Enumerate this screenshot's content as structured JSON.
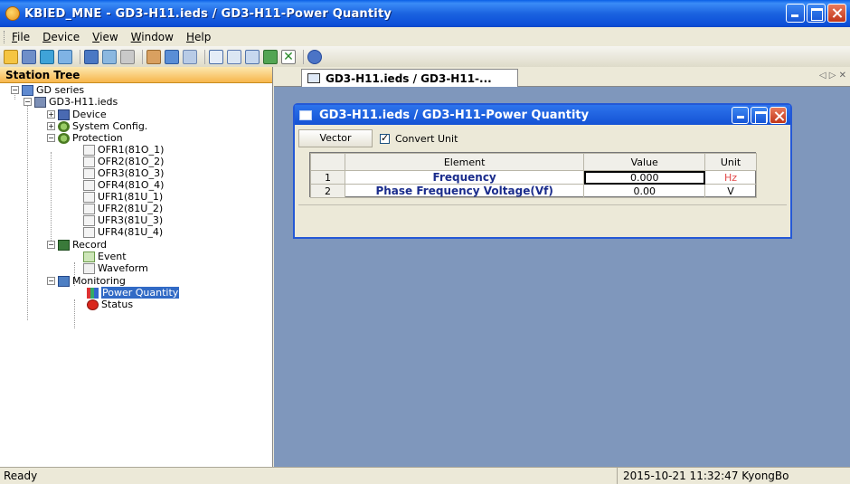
{
  "window": {
    "title": "KBIED_MNE - GD3-H11.ieds / GD3-H11-Power Quantity"
  },
  "menu": [
    "File",
    "Device",
    "View",
    "Window",
    "Help"
  ],
  "station_tree": {
    "header": "Station Tree",
    "items": [
      {
        "label": "GD series"
      },
      {
        "label": "GD3-H11.ieds"
      },
      {
        "label": "Device"
      },
      {
        "label": "System Config."
      },
      {
        "label": "Protection"
      },
      {
        "label": "OFR1(81O_1)"
      },
      {
        "label": "OFR2(81O_2)"
      },
      {
        "label": "OFR3(81O_3)"
      },
      {
        "label": "OFR4(81O_4)"
      },
      {
        "label": "UFR1(81U_1)"
      },
      {
        "label": "UFR2(81U_2)"
      },
      {
        "label": "UFR3(81U_3)"
      },
      {
        "label": "UFR4(81U_4)"
      },
      {
        "label": "Record"
      },
      {
        "label": "Event"
      },
      {
        "label": "Waveform"
      },
      {
        "label": "Monitoring"
      },
      {
        "label": "Power Quantity"
      },
      {
        "label": "Status"
      }
    ]
  },
  "tab": {
    "label": "GD3-H11.ieds / GD3-H11-..."
  },
  "child_window": {
    "title": "GD3-H11.ieds / GD3-H11-Power Quantity",
    "vector_button": "Vector",
    "convert_unit_label": "Convert Unit",
    "table": {
      "headers": [
        "",
        "Element",
        "Value",
        "Unit"
      ],
      "rows": [
        {
          "index": "1",
          "element": "Frequency",
          "value": "0.000",
          "unit": "Hz"
        },
        {
          "index": "2",
          "element": "Phase Frequency Voltage(Vf)",
          "value": "0.00",
          "unit": "V"
        }
      ]
    }
  },
  "statusbar": {
    "left": "Ready",
    "right": "2015-10-21 11:32:47  KyongBo"
  }
}
